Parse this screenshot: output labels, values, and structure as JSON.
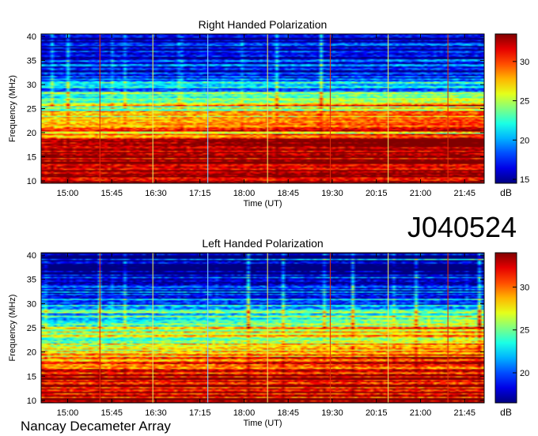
{
  "chart_data": [
    {
      "type": "heatmap",
      "title": "Right Handed Polarization",
      "xlabel": "Time (UT)",
      "ylabel": "Frequency (MHz)",
      "x_ticks": [
        "15:00",
        "15:45",
        "16:30",
        "17:15",
        "18:00",
        "18:45",
        "19:30",
        "20:15",
        "21:00",
        "21:45"
      ],
      "y_ticks": [
        10,
        15,
        20,
        25,
        30,
        35,
        40
      ],
      "ylim": [
        9.5,
        40.5
      ],
      "colorbar": {
        "label": "dB",
        "ticks": [
          15,
          20,
          25,
          30
        ],
        "range": [
          14.5,
          33.5
        ],
        "colormap": "jet"
      },
      "time_markers": [
        {
          "time": "15:33",
          "color": "#e0300a"
        },
        {
          "time": "16:27",
          "color": "#e8e860"
        },
        {
          "time": "17:23",
          "color": "#7fd0ff"
        },
        {
          "time": "18:24",
          "color": "#e8e860"
        },
        {
          "time": "19:28",
          "color": "#e0300a"
        },
        {
          "time": "20:27",
          "color": "#e8e860"
        },
        {
          "time": "21:28",
          "color": "#e0300a"
        }
      ],
      "spectral_profile": [
        {
          "freq": 10,
          "db": 31
        },
        {
          "freq": 12,
          "db": 33
        },
        {
          "freq": 15,
          "db": 33
        },
        {
          "freq": 18,
          "db": 32
        },
        {
          "freq": 20,
          "db": 29
        },
        {
          "freq": 22,
          "db": 27
        },
        {
          "freq": 24,
          "db": 26
        },
        {
          "freq": 26,
          "db": 25
        },
        {
          "freq": 28,
          "db": 22
        },
        {
          "freq": 31,
          "db": 19
        },
        {
          "freq": 34,
          "db": 17
        },
        {
          "freq": 38,
          "db": 16
        },
        {
          "freq": 40,
          "db": 15.5
        }
      ]
    },
    {
      "type": "heatmap",
      "title": "Left Handed Polarization",
      "xlabel": "Time (UT)",
      "ylabel": "Frequency (MHz)",
      "x_ticks": [
        "15:00",
        "15:45",
        "16:30",
        "17:15",
        "18:00",
        "18:45",
        "19:30",
        "20:15",
        "21:00",
        "21:45"
      ],
      "y_ticks": [
        10,
        15,
        20,
        25,
        30,
        35,
        40
      ],
      "ylim": [
        9.5,
        40.5
      ],
      "colorbar": {
        "label": "dB",
        "ticks": [
          20,
          25,
          30
        ],
        "range": [
          16.5,
          34
        ],
        "colormap": "jet"
      },
      "time_markers": [
        {
          "time": "15:33",
          "color": "#e0300a"
        },
        {
          "time": "16:27",
          "color": "#e8e860"
        },
        {
          "time": "17:23",
          "color": "#7fd0ff"
        },
        {
          "time": "18:24",
          "color": "#e8e860"
        },
        {
          "time": "19:28",
          "color": "#e0300a"
        },
        {
          "time": "20:27",
          "color": "#e8e860"
        },
        {
          "time": "21:28",
          "color": "#e0300a"
        }
      ],
      "spectral_profile": [
        {
          "freq": 10,
          "db": 32
        },
        {
          "freq": 12,
          "db": 33
        },
        {
          "freq": 15,
          "db": 33
        },
        {
          "freq": 18,
          "db": 31
        },
        {
          "freq": 20,
          "db": 29
        },
        {
          "freq": 22,
          "db": 27
        },
        {
          "freq": 24,
          "db": 26
        },
        {
          "freq": 26,
          "db": 25
        },
        {
          "freq": 28,
          "db": 23
        },
        {
          "freq": 31,
          "db": 20
        },
        {
          "freq": 34,
          "db": 18
        },
        {
          "freq": 38,
          "db": 17
        },
        {
          "freq": 40,
          "db": 16.5
        }
      ]
    }
  ],
  "figure": {
    "observation_id": "J040524",
    "instrument": "Nancay Decameter Array"
  }
}
